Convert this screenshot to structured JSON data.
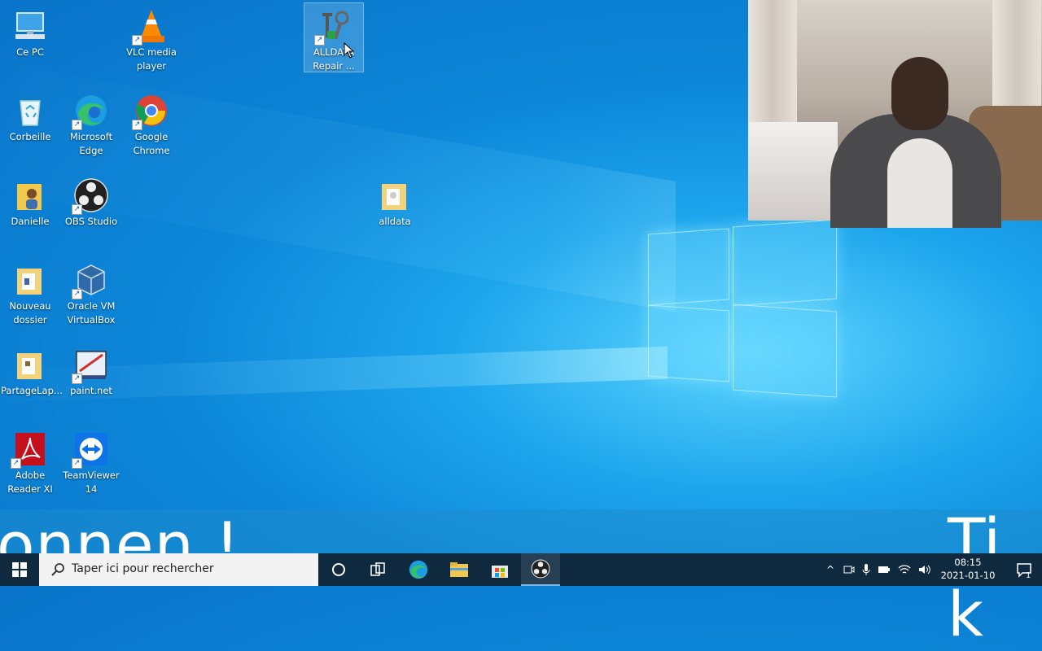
{
  "desktop": {
    "icons": [
      {
        "label": "Ce PC"
      },
      {
        "label": "VLC media player"
      },
      {
        "label": "ALLDATA Repair ..."
      },
      {
        "label": "Corbeille"
      },
      {
        "label": "Microsoft Edge"
      },
      {
        "label": "Google Chrome"
      },
      {
        "label": "Danielle"
      },
      {
        "label": "OBS Studio"
      },
      {
        "label": "alldata"
      },
      {
        "label": "Nouveau dossier"
      },
      {
        "label": "Oracle VM VirtualBox"
      },
      {
        "label": "PartageLap..."
      },
      {
        "label": "paint.net"
      },
      {
        "label": "Adobe Reader XI"
      },
      {
        "label": "TeamViewer 14"
      }
    ]
  },
  "overlay": {
    "caption_left": "onnen !",
    "caption_right": "Ti k"
  },
  "taskbar": {
    "search_placeholder": "Taper ici pour rechercher",
    "time": "08:15",
    "date": "2021-01-10",
    "notification_count": "1",
    "pinned": [
      "cortana-icon",
      "task-view-icon",
      "edge-icon",
      "file-explorer-icon",
      "store-icon",
      "obs-icon"
    ]
  },
  "colors": {
    "taskbar": "#0f2a3f",
    "desktop_accent": "#0c86d8"
  }
}
